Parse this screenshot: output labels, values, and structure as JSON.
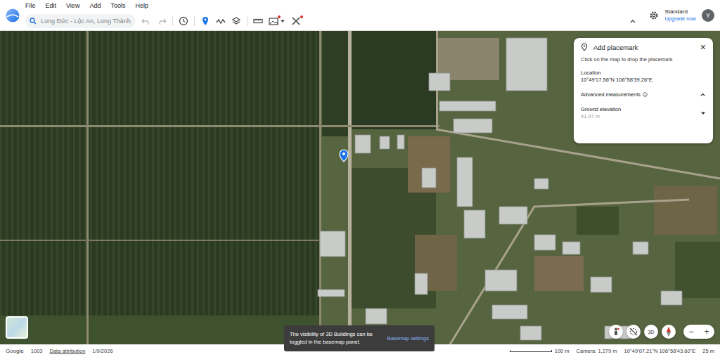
{
  "menu": [
    "File",
    "Edit",
    "View",
    "Add",
    "Tools",
    "Help"
  ],
  "search": {
    "value": "Long Đức - Lộc An, Long Thành,"
  },
  "account": {
    "plan": "Standard",
    "upgrade": "Upgrade now",
    "avatar": "Y"
  },
  "placemark_panel": {
    "title": "Add placemark",
    "close": "×",
    "hint": "Click on the map to drop the placemark",
    "location_label": "Location",
    "location_value": "10°49'17.56\"N 106°58'39.26\"E",
    "advanced_label": "Advanced measurements",
    "advanced_expanded": true,
    "ground_elevation_label": "Ground elevation",
    "ground_elevation_value": "41.97 m"
  },
  "toast": {
    "message": "The visibility of 3D Buildings can be toggled in the basemap panel.",
    "action": "Basemap settings"
  },
  "map_controls": {
    "view_3d": "3D",
    "zoom_out": "−",
    "zoom_in": "+"
  },
  "status_bar": {
    "brand": "Google",
    "number": "1003",
    "attribution": "Data attribution",
    "date": "1/9/2026",
    "scale": "100 m",
    "camera": "Camera: 1,279 m",
    "coordinates": "10°49'07.21\"N 106°58'43.60\"E",
    "elevation": "25 m"
  }
}
